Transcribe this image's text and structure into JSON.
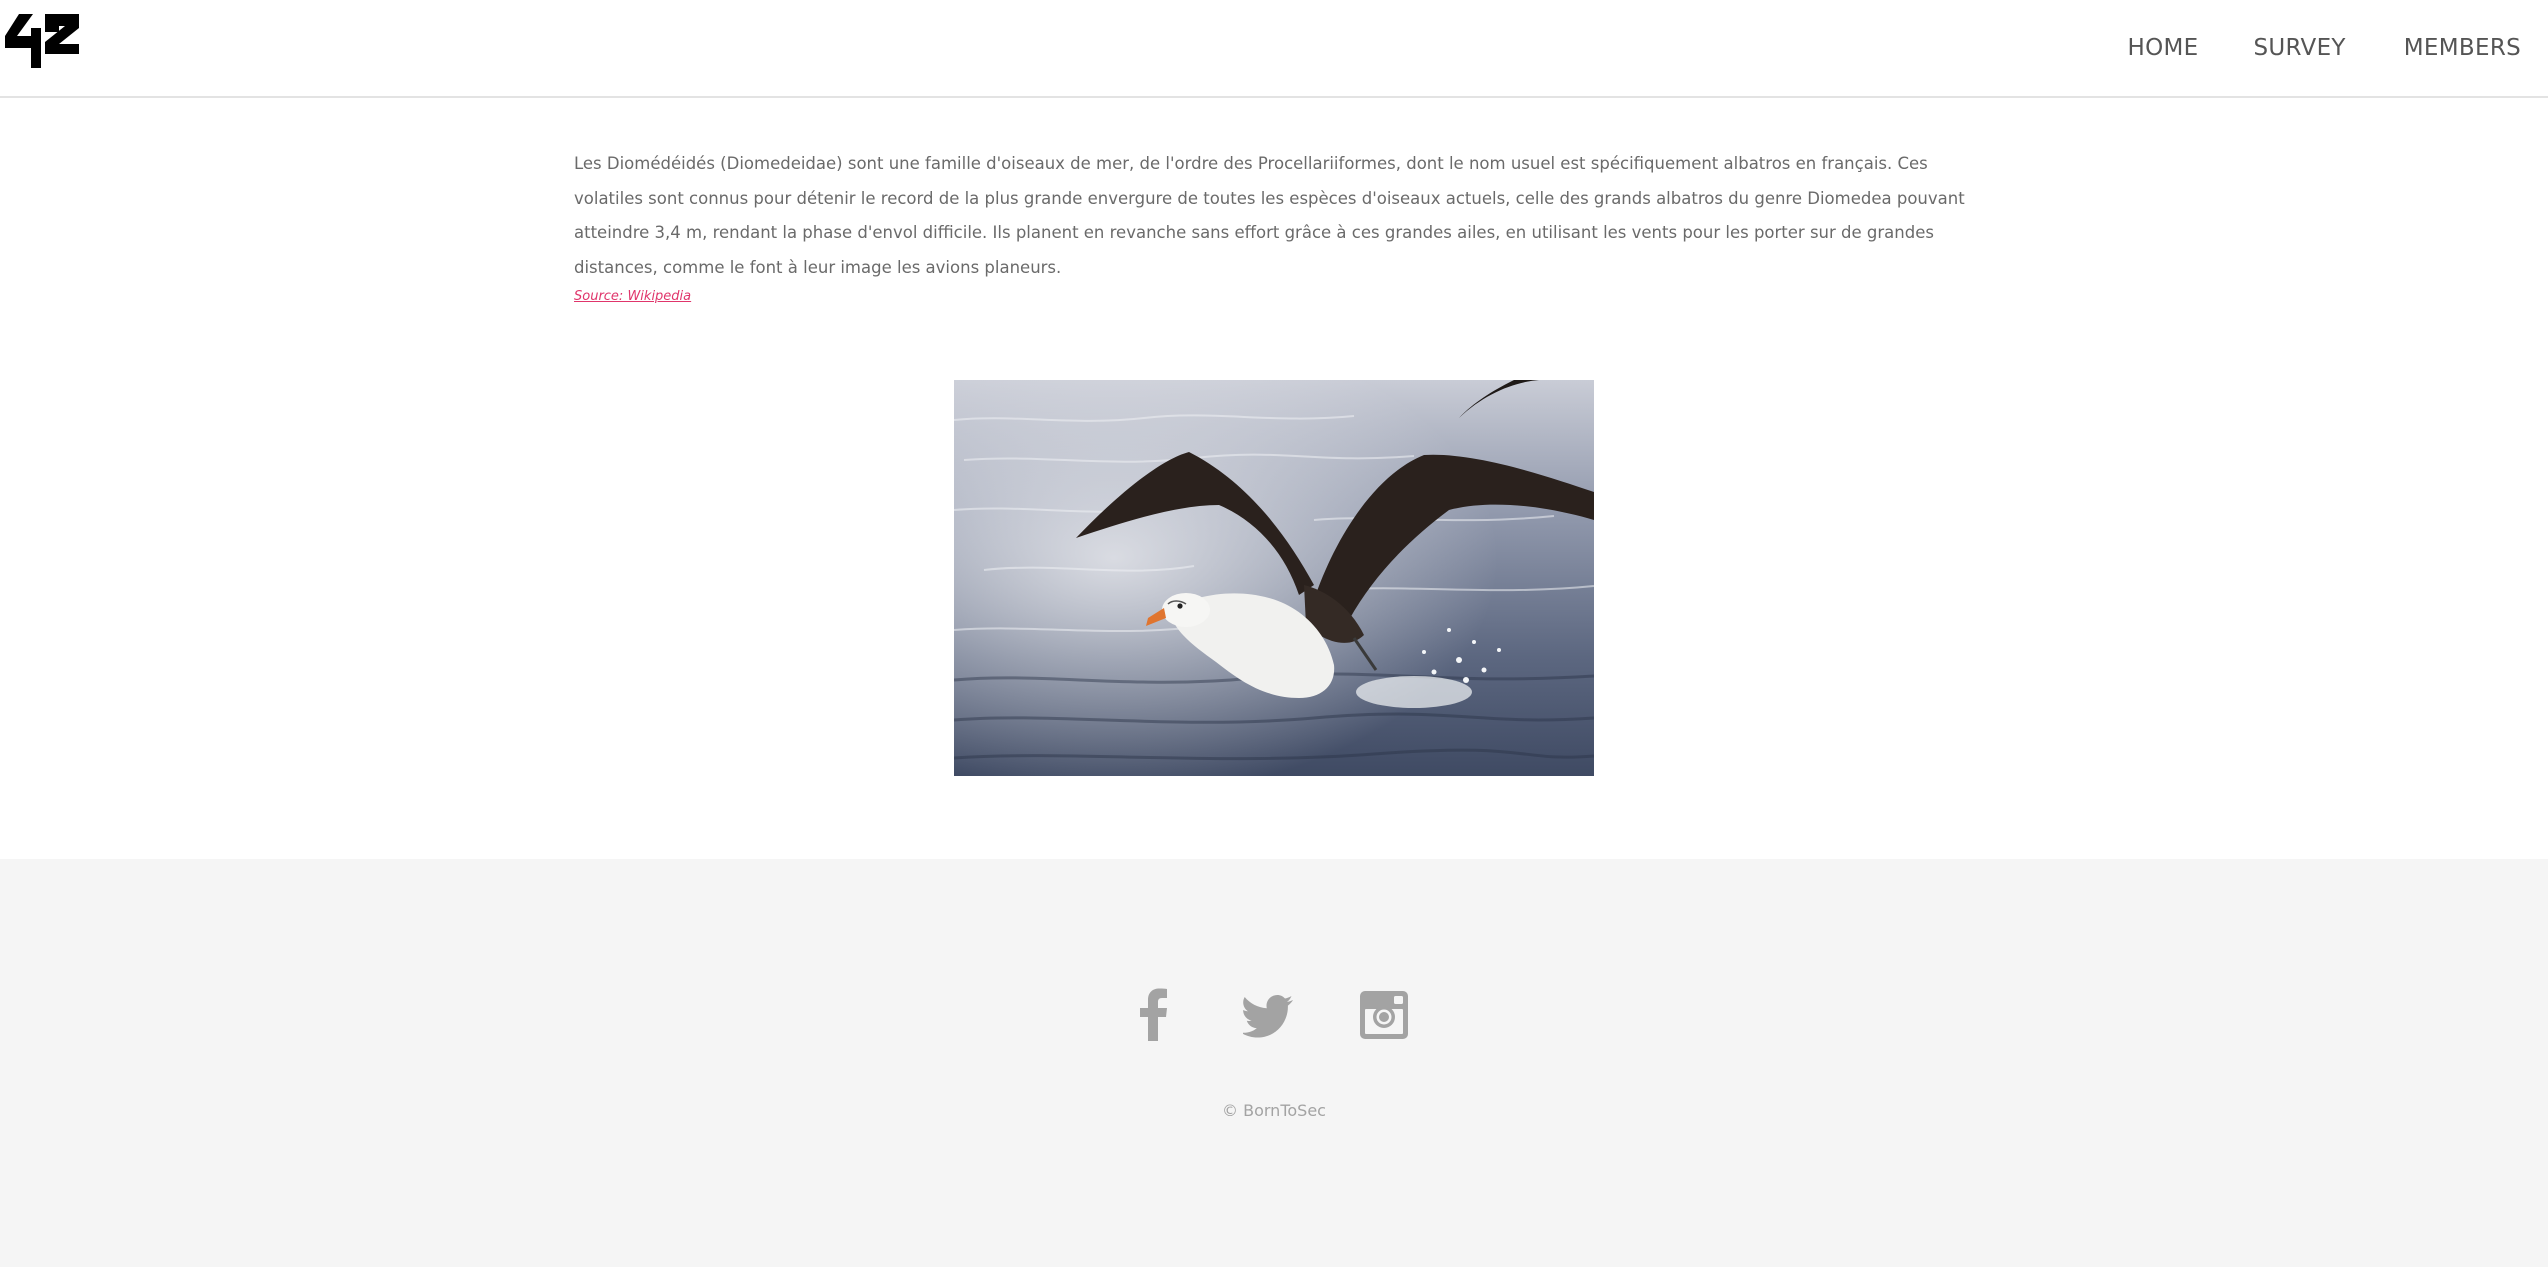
{
  "header": {
    "logo_text": "42",
    "nav": {
      "home": "HOME",
      "survey": "SURVEY",
      "members": "MEMBERS"
    }
  },
  "main": {
    "intro_text": "Les Diomédéidés (Diomedeidae) sont une famille d'oiseaux de mer, de l'ordre des Procellariiformes, dont le nom usuel est spécifiquement albatros en français. Ces volatiles sont connus pour détenir le record de la plus grande envergure de toutes les espèces d'oiseaux actuels, celle des grands albatros du genre Diomedea pouvant atteindre 3,4 m, rendant la phase d'envol difficile. Ils planent en revanche sans effort grâce à ces grandes ailes, en utilisant les vents pour les porter sur de grandes distances, comme le font à leur image les avions planeurs.",
    "source_link": "Source: Wikipedia",
    "photo_subject": "albatross-taking-off-from-water"
  },
  "footer": {
    "social_icons": [
      "facebook-icon",
      "twitter-icon",
      "instagram-icon"
    ],
    "copyright": "© BornToSec"
  },
  "colors": {
    "link_accent": "#e0356b",
    "nav_text": "#555555",
    "body_text": "#6a6a6a",
    "footer_bg": "#f5f5f5",
    "footer_icon": "#a3a3a3"
  }
}
